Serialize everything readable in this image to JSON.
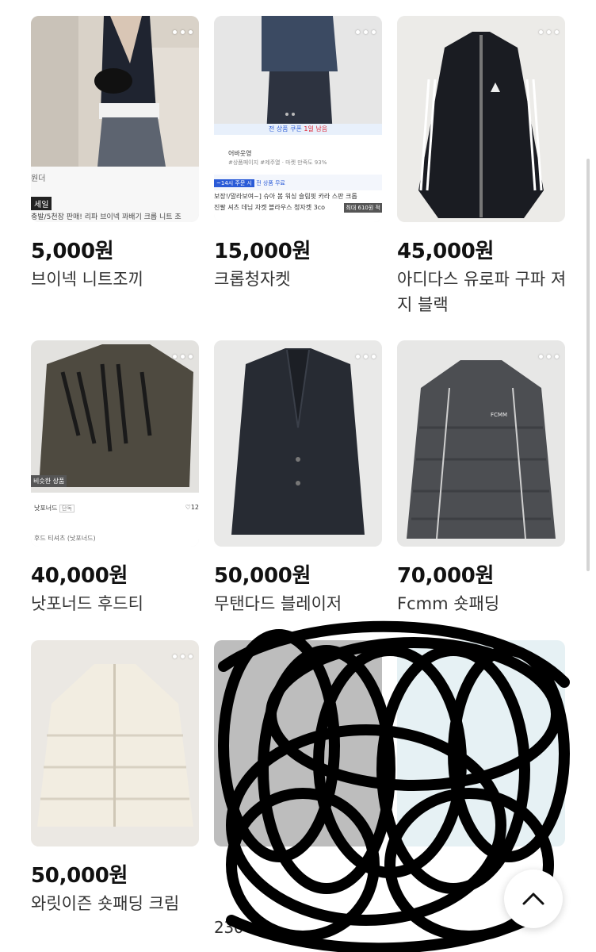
{
  "products": [
    {
      "price": "5,000원",
      "title": "브이넥 니트조끼"
    },
    {
      "price": "15,000원",
      "title": "크롭청자켓"
    },
    {
      "price": "45,000원",
      "title": "아디다스 유로파 구파 져지 블랙"
    },
    {
      "price": "40,000원",
      "title": "낫포너드 후드티"
    },
    {
      "price": "50,000원",
      "title": "무탠다드 블레이저"
    },
    {
      "price": "70,000원",
      "title": "Fcmm 숏패딩"
    },
    {
      "price": "50,000원",
      "title": "와릿이즌 숏패딩 크림"
    },
    {
      "price": "230 ulc",
      "title": ""
    }
  ],
  "thumb_overlays": {
    "p1": {
      "shop": "원더",
      "tag": "세일",
      "desc": "충발/5천장 판매! 리파 브이넥 꽈배기 크롭 니트 조"
    },
    "p2": {
      "coupon": "전 상품 쿠폰",
      "coupon_left": "1일 남음",
      "seller": "어바웃영",
      "seller_tags": "#상품페이지 #제주열 · 마켓 만족도 93%",
      "promo": "~14시 주문 시",
      "promo2": "전 상품 무료",
      "line1": "보장!/말라보여~] 슈아 봄 워싱 슬림핏 카라 스판 크롭",
      "line2": "진팔 셔츠 데님 자켓 블라우스 청자켓 3co",
      "count": "최대 610원 적"
    },
    "p4": {
      "badge": "비슷한 상품",
      "seller": "낫포너드",
      "seller_tag": "단독",
      "likes": "12",
      "desc": "후드 티셔츠 (낫포너드)"
    },
    "p6": {
      "label": "FCMM"
    }
  },
  "icons": {
    "more": "more-dots-icon",
    "up": "chevron-up-icon"
  }
}
